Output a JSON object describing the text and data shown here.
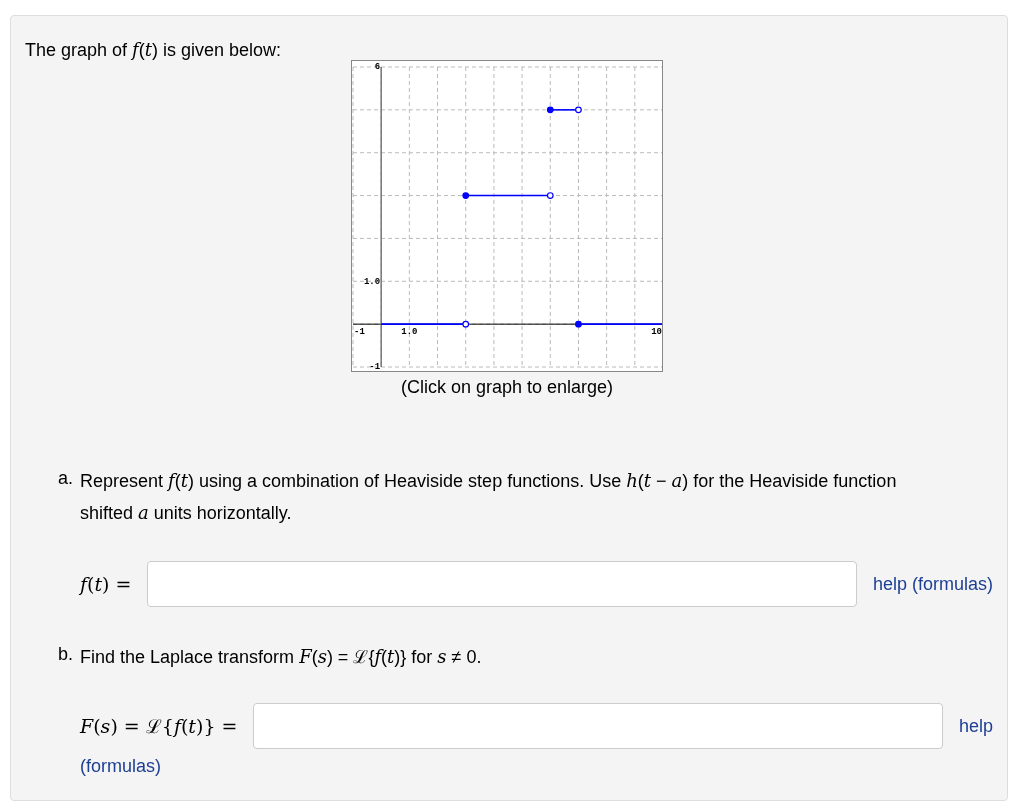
{
  "intro": "The graph of *f*(*t*) is given below:",
  "graph": {
    "caption": "(Click on graph to enlarge)",
    "chart_data": {
      "type": "line",
      "xlim": [
        -1,
        10
      ],
      "ylim": [
        -1,
        6
      ],
      "xticks": [
        {
          "value": -1,
          "label": "-1"
        },
        {
          "value": 1,
          "label": "1.0"
        },
        {
          "value": 10,
          "label": "10"
        }
      ],
      "yticks": [
        {
          "value": -1,
          "label": "-1"
        },
        {
          "value": 1,
          "label": "1.0"
        },
        {
          "value": 6,
          "label": "6"
        }
      ],
      "x": [
        0,
        3,
        6,
        7,
        10
      ],
      "series": [
        {
          "color": "#0000ff",
          "marker": "o",
          "values": [
            0,
            0,
            null,
            null,
            null
          ]
        },
        {
          "color": "#0000ff",
          "marker": "o",
          "values": [
            null,
            3,
            3,
            null,
            null
          ]
        },
        {
          "color": "#0000ff",
          "marker": "o",
          "values": [
            null,
            null,
            5,
            5,
            null
          ]
        },
        {
          "color": "#0000ff",
          "marker": "o",
          "values": [
            null,
            null,
            null,
            0,
            0
          ]
        }
      ]
    }
  },
  "parts": [
    {
      "marker": "a.",
      "prompt": "Represent *f*(*t*) using a combination of Heaviside step functions. Use *h*(*t* − *a*) for the Heaviside function shifted *a* units horizontally.",
      "label": "*f*(*t*) =",
      "help_lines": [
        "help (formulas)"
      ]
    },
    {
      "marker": "b.",
      "prompt": "Find the Laplace transform *F*(*s*) = ℒ{*f*(*t*)} for *s* ≠ 0.",
      "label": "*F*(*s*) = ℒ{*f*(*t*)} =",
      "help_lines": [
        "help",
        "(formulas)"
      ]
    }
  ]
}
